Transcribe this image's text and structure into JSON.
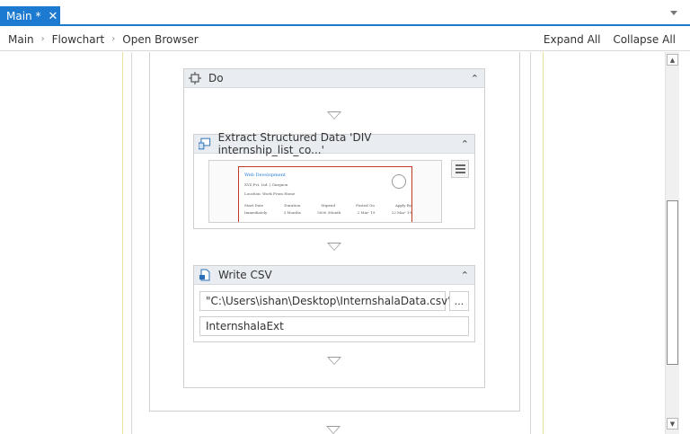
{
  "tabs": [
    {
      "label": "Main *",
      "close": "✕"
    }
  ],
  "breadcrumb": [
    "Main",
    "Flowchart",
    "Open Browser"
  ],
  "breadcrumb_separator": "›",
  "actions": {
    "expand_all": "Expand All",
    "collapse_all": "Collapse All"
  },
  "do_container": {
    "title": "Do",
    "collapse_glyph": "⌃"
  },
  "extract_activity": {
    "title": "Extract Structured Data 'DIV  internship_list_co...'",
    "preview": {
      "heading": "Web Development",
      "line1": "XYZ Pvt. Ltd. | Gurgaon",
      "line2": "Location: Work From Home",
      "table_headers": [
        "Start Date",
        "Duration",
        "Stipend",
        "Posted On",
        "Apply By"
      ],
      "table_values": [
        "Immediately",
        "3 Months",
        "5000 /Month",
        "2 Mar' 19",
        "22 Mar' 19"
      ]
    }
  },
  "write_csv": {
    "title": "Write CSV",
    "file_path": "\"C:\\Users\\ishan\\Desktop\\InternshalaData.csv\"",
    "browse_label": "...",
    "datatable": "InternshalaExt"
  },
  "scrollbar": {
    "up": "▲",
    "down": "▼"
  }
}
